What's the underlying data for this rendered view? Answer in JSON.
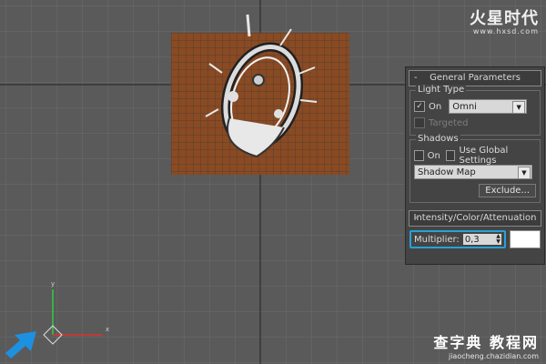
{
  "logo": {
    "main": "火星时代",
    "sub": "www.hxsd.com"
  },
  "watermark": {
    "main": "查字典 教程网",
    "sub": "jiaocheng.chazidian.com"
  },
  "panel": {
    "general_rollout": "General Parameters",
    "light_type": {
      "title": "Light Type",
      "on_checked": true,
      "on_label": "On",
      "type_value": "Omni",
      "targeted_label": "Targeted"
    },
    "shadows": {
      "title": "Shadows",
      "on_label": "On",
      "global_label": "Use Global Settings",
      "type_value": "Shadow Map",
      "exclude_label": "Exclude..."
    },
    "intensity_rollout": "Intensity/Color/Attenuation",
    "multiplier": {
      "label": "Multiplier:",
      "value": "0,3"
    }
  },
  "axes": {
    "x": "x",
    "y": "y"
  },
  "colors": {
    "highlight": "#2aa0d8",
    "plane": "#8a4a22",
    "arrow": "#1e90e0"
  },
  "icons": [
    "rollout-minus-icon",
    "checkbox-check-icon",
    "dropdown-arrow-icon",
    "spinner-arrows-icon",
    "axis-gizmo-icon",
    "pointer-arrow-icon"
  ]
}
